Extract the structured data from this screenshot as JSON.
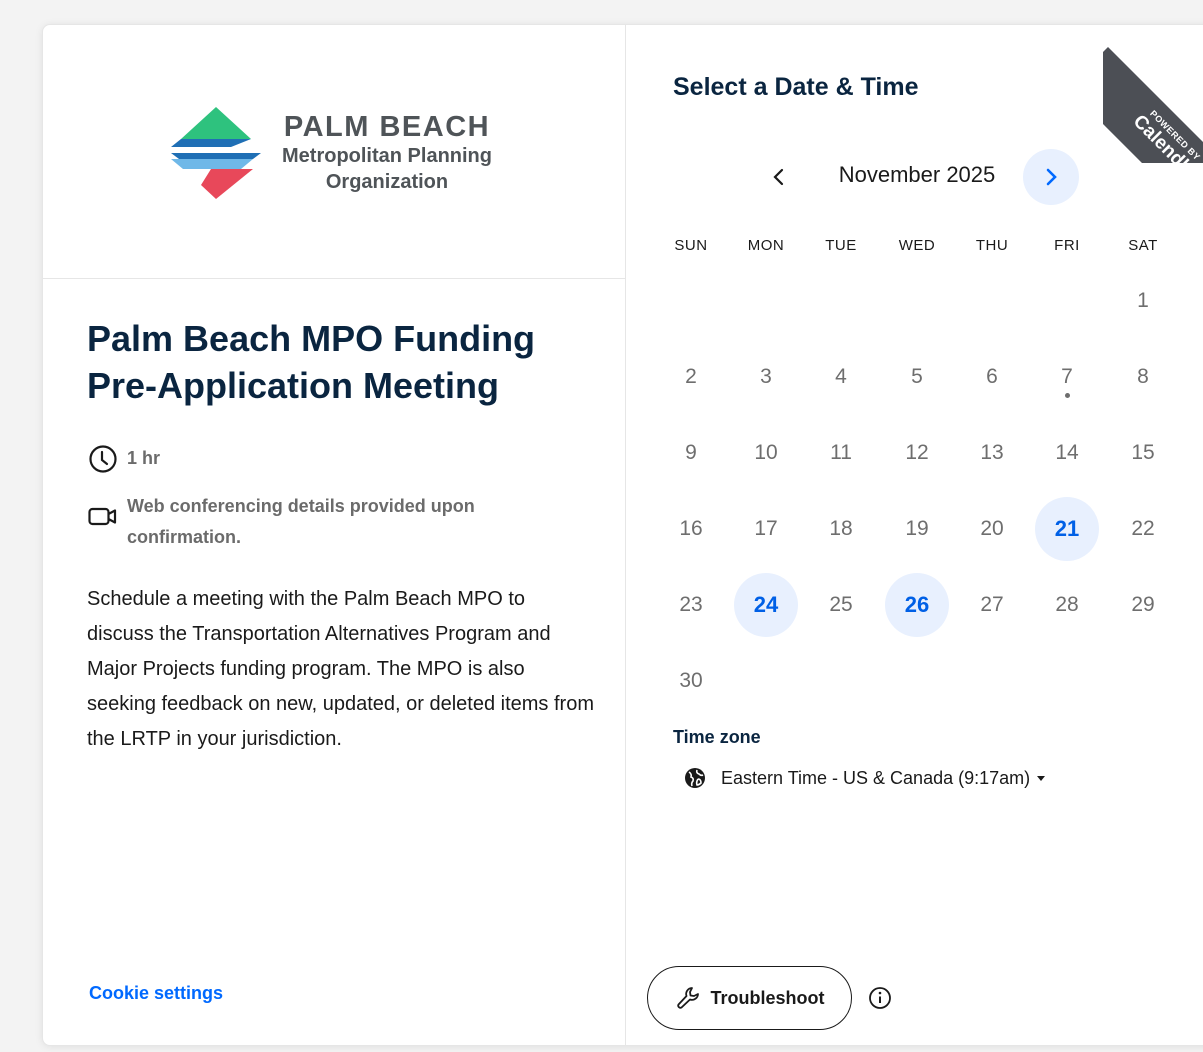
{
  "organization": {
    "name": "PALM BEACH",
    "subtitle_line1": "Metropolitan Planning",
    "subtitle_line2": "Organization",
    "logo_colors": [
      "#2ec27e",
      "#1f6fb5",
      "#6fb8e8",
      "#e8485a"
    ]
  },
  "event": {
    "title": "Palm Beach MPO Funding Pre-Application Meeting",
    "duration": "1 hr",
    "location": "Web conferencing details provided upon confirmation.",
    "description": "Schedule a meeting with the Palm Beach MPO to discuss the Transportation Alternatives Program and Major Projects funding program. The MPO is also seeking feedback on new, updated, or deleted items from the LRTP in your jurisdiction."
  },
  "footer": {
    "cookie_settings": "Cookie settings"
  },
  "calendar": {
    "heading": "Select a Date & Time",
    "month": "November 2025",
    "weekdays": [
      "SUN",
      "MON",
      "TUE",
      "WED",
      "THU",
      "FRI",
      "SAT"
    ],
    "days": [
      "1",
      "2",
      "3",
      "4",
      "5",
      "6",
      "7",
      "8",
      "9",
      "10",
      "11",
      "12",
      "13",
      "14",
      "15",
      "16",
      "17",
      "18",
      "19",
      "20",
      "21",
      "22",
      "23",
      "24",
      "25",
      "26",
      "27",
      "28",
      "29",
      "30"
    ],
    "first_weekday_index": 6,
    "available_days": [
      "21",
      "24",
      "26"
    ],
    "today": "7",
    "accent_color": "#0069ff"
  },
  "timezone": {
    "label": "Time zone",
    "value": "Eastern Time - US & Canada (9:17am)"
  },
  "troubleshoot": {
    "label": "Troubleshoot"
  },
  "branding": {
    "powered_by": "POWERED BY",
    "name": "Calendly"
  }
}
